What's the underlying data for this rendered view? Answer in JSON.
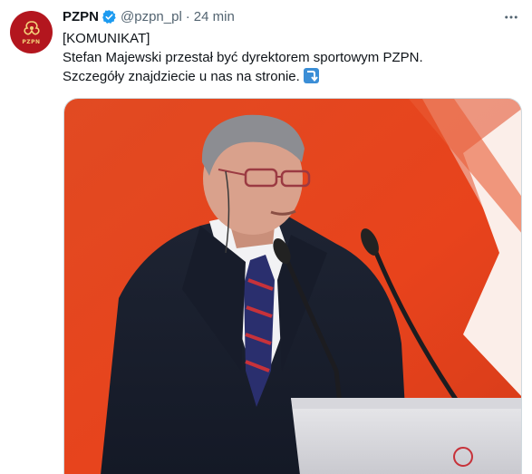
{
  "tweet": {
    "author_name": "PZPN",
    "handle": "@pzpn_pl",
    "separator": "·",
    "time": "24 min",
    "avatar_text": "PZPN",
    "lines": [
      "[KOMUNIKAT]",
      "Stefan Majewski przestał być dyrektorem sportowym PZPN.",
      "Szczegóły znajdziecie u nas na stronie."
    ],
    "emoji_icon": "right-arrow-curving-down-emoji-icon",
    "photo_subject": "man-speaking-at-lectern-photo"
  },
  "colors": {
    "accent_verified": "#1d9bf0",
    "avatar_bg": "#b3161e",
    "photo_bg_red": "#e4441f",
    "text_secondary": "#536471"
  }
}
